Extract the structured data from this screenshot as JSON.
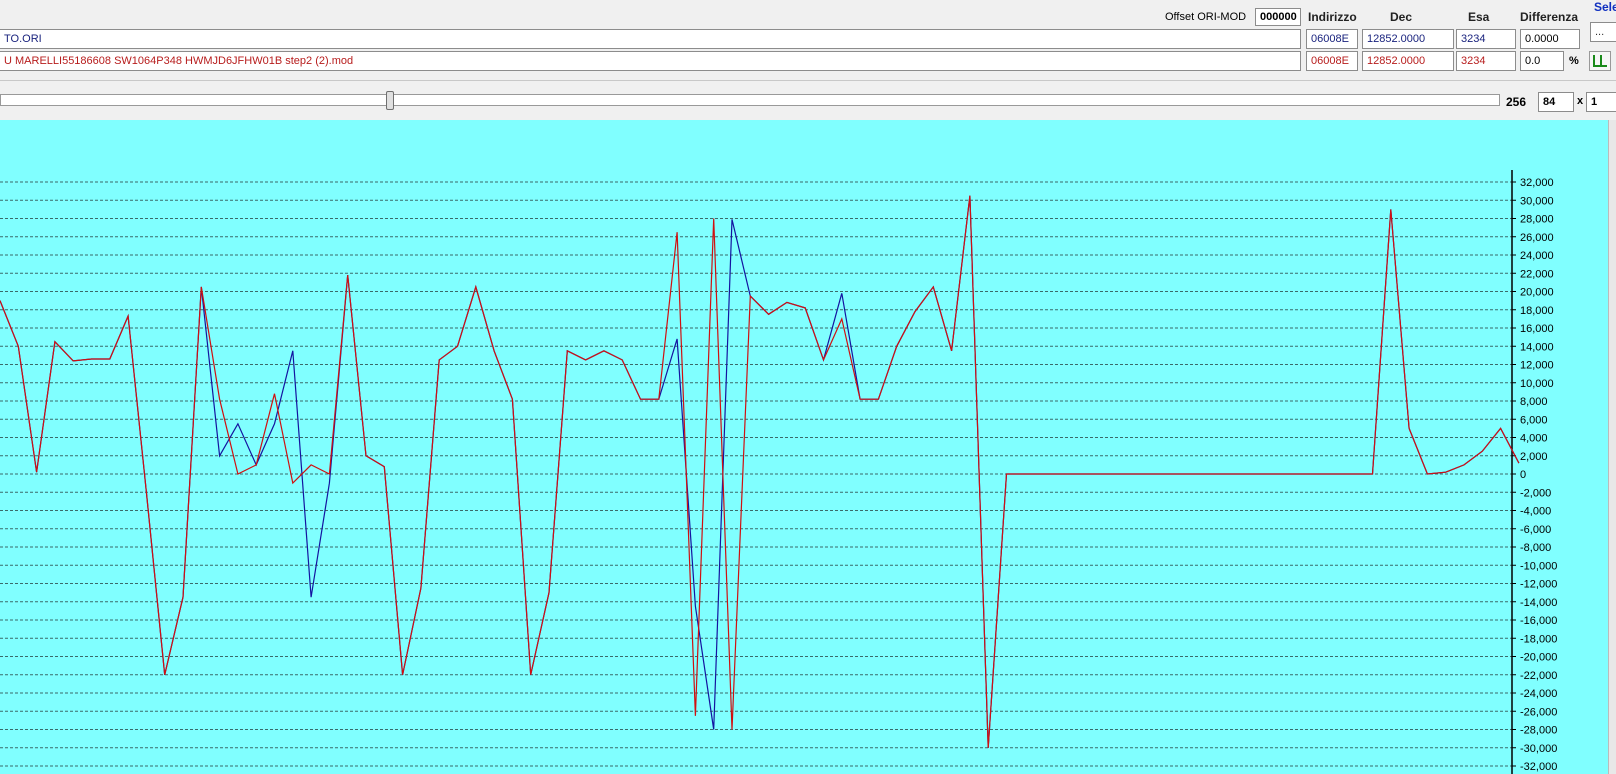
{
  "header": {
    "offset_label": "Offset ORI-MOD",
    "offset_value": "000000",
    "col_address": "Indirizzo",
    "col_dec": "Dec",
    "col_hex": "Esa",
    "col_diff": "Differenza",
    "sel_label": "Sele",
    "sel_value": "..."
  },
  "rows": [
    {
      "file": "TO.ORI",
      "address": "06008E",
      "dec": "12852.0000",
      "hex": "3234",
      "diff": "0.0000"
    },
    {
      "file": "U  MARELLI55186608  SW1064P348   HWMJD6JFHW01B step2 (2).mod",
      "address": "06008E",
      "dec": "12852.0000",
      "hex": "3234",
      "diff": "0.0",
      "diff_unit": "%"
    }
  ],
  "toolbar": {
    "width_label": "256",
    "cols_value": "84",
    "times_label": "x",
    "rows_value": "1"
  },
  "colors": {
    "background": "#80ffff",
    "ori_series": "#1414a0",
    "mod_series": "#d01010",
    "gridline": "#3a6a6a"
  },
  "chart_data": {
    "type": "line",
    "ylim": [
      -32000,
      32000
    ],
    "ytick_step": 2000,
    "grid": true,
    "y_ticks": [
      "32,000",
      "30,000",
      "28,000",
      "26,000",
      "24,000",
      "22,000",
      "20,000",
      "18,000",
      "16,000",
      "14,000",
      "12,000",
      "10,000",
      "8,000",
      "6,000",
      "4,000",
      "2,000",
      "0",
      "-2,000",
      "-4,000",
      "-6,000",
      "-8,000",
      "-10,000",
      "-12,000",
      "-14,000",
      "-16,000",
      "-18,000",
      "-20,000",
      "-22,000",
      "-24,000",
      "-26,000",
      "-28,000",
      "-30,000",
      "-32,000"
    ],
    "x": [
      0,
      1,
      2,
      3,
      4,
      5,
      6,
      7,
      8,
      9,
      10,
      11,
      12,
      13,
      14,
      15,
      16,
      17,
      18,
      19,
      20,
      21,
      22,
      23,
      24,
      25,
      26,
      27,
      28,
      29,
      30,
      31,
      32,
      33,
      34,
      35,
      36,
      37,
      38,
      39,
      40,
      41,
      42,
      43,
      44,
      45,
      46,
      47,
      48,
      49,
      50,
      51,
      52,
      53,
      54,
      55,
      56,
      57,
      58,
      59,
      60,
      61,
      62,
      63,
      64,
      65,
      66,
      67,
      68,
      69,
      70,
      71,
      72,
      73,
      74,
      75,
      76,
      77,
      78,
      79,
      80,
      81,
      82,
      83
    ],
    "series": [
      {
        "values": [
          19000,
          14000,
          200,
          14500,
          12400,
          12600,
          12600,
          17300,
          -2000,
          -22000,
          -13500,
          20500,
          2000,
          5500,
          1000,
          5500,
          13500,
          -13500,
          -1000,
          21800,
          2000,
          800,
          -22000,
          -12500,
          12500,
          14000,
          20500,
          13500,
          8200,
          -22000,
          -13000,
          13500,
          12500,
          13500,
          12500,
          8200,
          8200,
          14800,
          -14500,
          -28000,
          27900,
          19500,
          17500,
          18800,
          18200,
          12500,
          19800,
          8200,
          8200,
          14000,
          17800,
          20500,
          13500,
          30500,
          -30000,
          0,
          0,
          0,
          0,
          0,
          0,
          0,
          0,
          0,
          0,
          0,
          0,
          0,
          0,
          0,
          0,
          0,
          0,
          0,
          0,
          0,
          29000,
          5000,
          0,
          200,
          1000,
          2500,
          5000,
          1200
        ]
      },
      {
        "values": [
          19000,
          14000,
          200,
          14500,
          12400,
          12600,
          12600,
          17300,
          -2000,
          -22000,
          -13500,
          20500,
          8200,
          0,
          1000,
          8800,
          -1000,
          1000,
          0,
          21800,
          2000,
          800,
          -22000,
          -12500,
          12500,
          14000,
          20500,
          13500,
          8200,
          -22000,
          -13000,
          13500,
          12500,
          13500,
          12500,
          8200,
          8200,
          26500,
          -26500,
          28000,
          -28000,
          19500,
          17500,
          18800,
          18200,
          12500,
          17000,
          8200,
          8200,
          14000,
          17800,
          20500,
          13500,
          30500,
          -30000,
          0,
          0,
          0,
          0,
          0,
          0,
          0,
          0,
          0,
          0,
          0,
          0,
          0,
          0,
          0,
          0,
          0,
          0,
          0,
          0,
          0,
          29000,
          5000,
          0,
          200,
          1000,
          2500,
          5000,
          1200
        ]
      }
    ]
  }
}
